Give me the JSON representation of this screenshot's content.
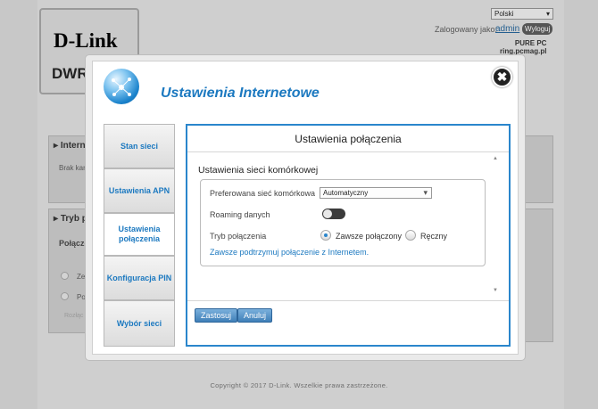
{
  "background": {
    "logo": "D-Link",
    "model": "DWR",
    "language": "Polski",
    "login_label": "Zalogowany jako:",
    "login_user": "admin",
    "logout_label": "Wyloguj",
    "panel1_title": "Interne",
    "panel1_text": "Brak kar",
    "panel2_title": "Tryb p",
    "panel2_sub": "Połączen",
    "radio1_text": "Ze",
    "radio2_text": "Po",
    "panel2_small": "Rozłąc",
    "footer": "Copyright © 2017 D-Link. Wszelkie prawa zastrzeżone.",
    "watermark_top": "PURE PC",
    "watermark_bottom": "ring.pcmag.pl"
  },
  "modal": {
    "title": "Ustawienia Internetowe",
    "close_label": "✖",
    "nav": [
      {
        "label": "Stan sieci"
      },
      {
        "label": "Ustawienia APN"
      },
      {
        "label": "Ustawienia połączenia"
      },
      {
        "label": "Konfiguracja PIN"
      },
      {
        "label": "Wybór sieci"
      }
    ],
    "content_title": "Ustawienia połączenia",
    "section_title": "Ustawienia sieci komórkowej",
    "preferred_label": "Preferowana sieć komórkowa",
    "preferred_value": "Automatyczny",
    "roaming_label": "Roaming danych",
    "mode_label": "Tryb połączenia",
    "mode_options": [
      "Zawsze połączony",
      "Ręczny"
    ],
    "mode_selected": "Zawsze połączony",
    "hint": "Zawsze podtrzymuj połączenie z Internetem.",
    "save_label": "Zastosuj",
    "cancel_label": "Anuluj"
  },
  "colors": {
    "accent": "#1c79c0",
    "border_active": "#2a86cc",
    "button": "#3f7fb8"
  }
}
